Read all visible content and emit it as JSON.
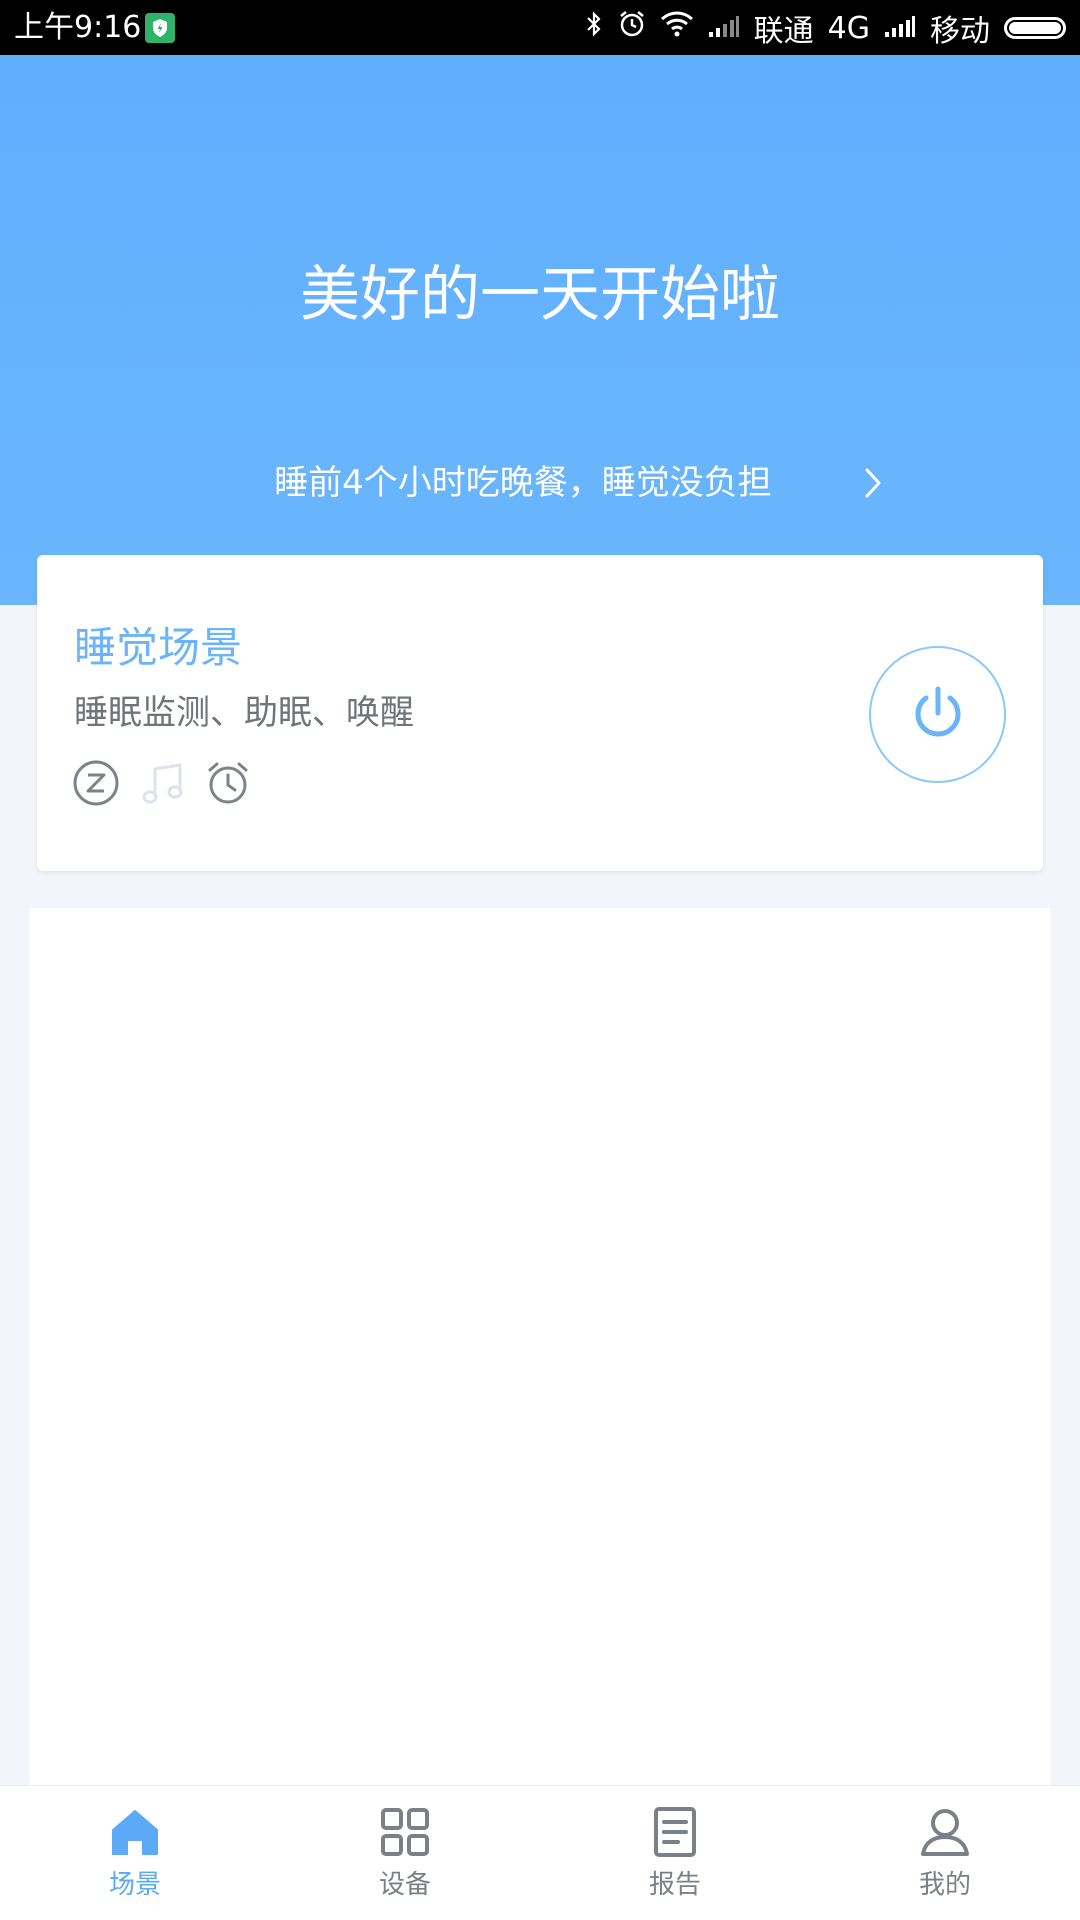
{
  "status_bar": {
    "time": "上午9:16",
    "carrier_1": "联通",
    "network": "4G",
    "carrier_2": "移动"
  },
  "header": {
    "greeting": "美好的一天开始啦",
    "tip": "睡前4个小时吃晚餐，睡觉没负担"
  },
  "scene_card": {
    "title": "睡觉场景",
    "subtitle": "睡眠监测、助眠、唤醒",
    "icons": [
      "sleep-z-icon",
      "music-note-icon",
      "alarm-clock-icon"
    ]
  },
  "bottom_nav": {
    "items": [
      {
        "label": "场景",
        "icon": "home-icon",
        "active": true
      },
      {
        "label": "设备",
        "icon": "grid-icon",
        "active": false
      },
      {
        "label": "报告",
        "icon": "report-icon",
        "active": false
      },
      {
        "label": "我的",
        "icon": "user-icon",
        "active": false
      }
    ]
  },
  "colors": {
    "header_blue": "#60aefe",
    "accent_blue": "#6cb4f9",
    "nav_active": "#5aaaf7",
    "nav_inactive": "#7b8087",
    "background": "#f4f5fa"
  }
}
